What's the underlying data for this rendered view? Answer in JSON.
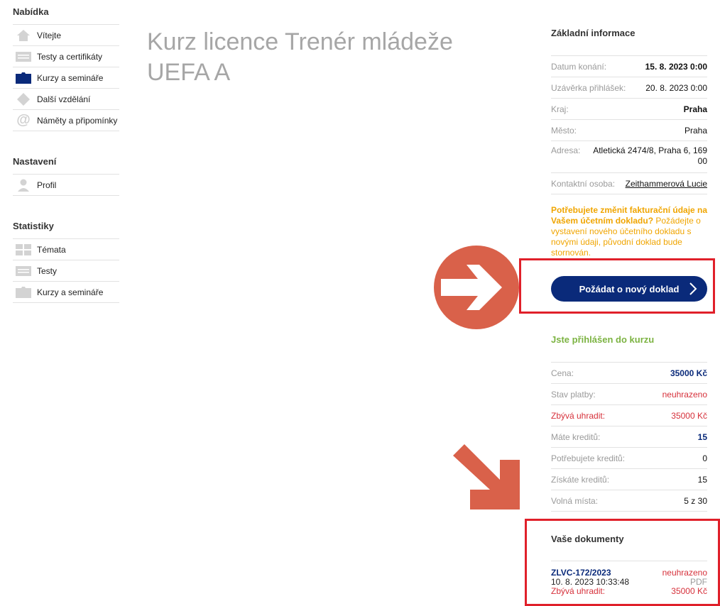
{
  "sidebar": {
    "sections": [
      {
        "title": "Nabídka",
        "items": [
          {
            "label": "Vítejte",
            "icon": "home-icon"
          },
          {
            "label": "Testy a certifikáty",
            "icon": "list-icon"
          },
          {
            "label": "Kurzy a semináře",
            "icon": "folder-icon",
            "active": true
          },
          {
            "label": "Další vzdělání",
            "icon": "diamond-icon"
          },
          {
            "label": "Náměty a připomínky",
            "icon": "at-icon"
          }
        ]
      },
      {
        "title": "Nastavení",
        "items": [
          {
            "label": "Profil",
            "icon": "user-icon"
          }
        ]
      },
      {
        "title": "Statistiky",
        "items": [
          {
            "label": "Témata",
            "icon": "grid-icon"
          },
          {
            "label": "Testy",
            "icon": "list-icon"
          },
          {
            "label": "Kurzy a semináře",
            "icon": "folder-icon"
          }
        ]
      }
    ]
  },
  "page": {
    "title_line1": "Kurz licence Trenér mládeže",
    "title_line2": "UEFA A"
  },
  "basic_info": {
    "title": "Základní informace",
    "rows": [
      {
        "key": "Datum konání:",
        "value": "15. 8. 2023 0:00"
      },
      {
        "key": "Uzávěrka přihlášek:",
        "value": "20. 8. 2023 0:00"
      },
      {
        "key": "Kraj:",
        "value": "Praha"
      },
      {
        "key": "Město:",
        "value": "Praha"
      },
      {
        "key": "Adresa:",
        "value": "Atletická 2474/8, Praha 6, 169 00"
      },
      {
        "key": "Kontaktní osoba:",
        "value": "Zeithammerová Lucie"
      }
    ]
  },
  "notice": {
    "bold": "Potřebujete změnit fakturační údaje na Vašem účetním dokladu?",
    "rest": " Požádejte o vystavení nového účetního dokladu s novými údaji, původní doklad bude stornován."
  },
  "request_button": {
    "label": "Požádat o nový doklad"
  },
  "enrolled": {
    "title": "Jste přihlášen do kurzu",
    "rows": [
      {
        "key": "Cena:",
        "value": "35000 Kč"
      },
      {
        "key": "Stav platby:",
        "value": "neuhrazeno"
      },
      {
        "key": "Zbývá uhradit:",
        "value": "35000 Kč"
      },
      {
        "key": "Máte kreditů:",
        "value": "15"
      },
      {
        "key": "Potřebujete kreditů:",
        "value": "0"
      },
      {
        "key": "Získáte kreditů:",
        "value": "15"
      },
      {
        "key": "Volná místa:",
        "value": "5 z 30"
      }
    ]
  },
  "documents": {
    "title": "Vaše dokumenty",
    "doc_id": "ZLVC-172/2023",
    "status": "neuhrazeno",
    "date": "10. 8. 2023 10:33:48",
    "format": "PDF",
    "due_label": "Zbývá uhradit:",
    "due_value": "35000 Kč"
  },
  "colors": {
    "navy": "#0a2a7a",
    "red": "#d6303a",
    "orange_notice": "#f0a500",
    "green": "#7cb342",
    "annotation_red": "#e0202a",
    "annotation_arrow": "#d9614a"
  }
}
